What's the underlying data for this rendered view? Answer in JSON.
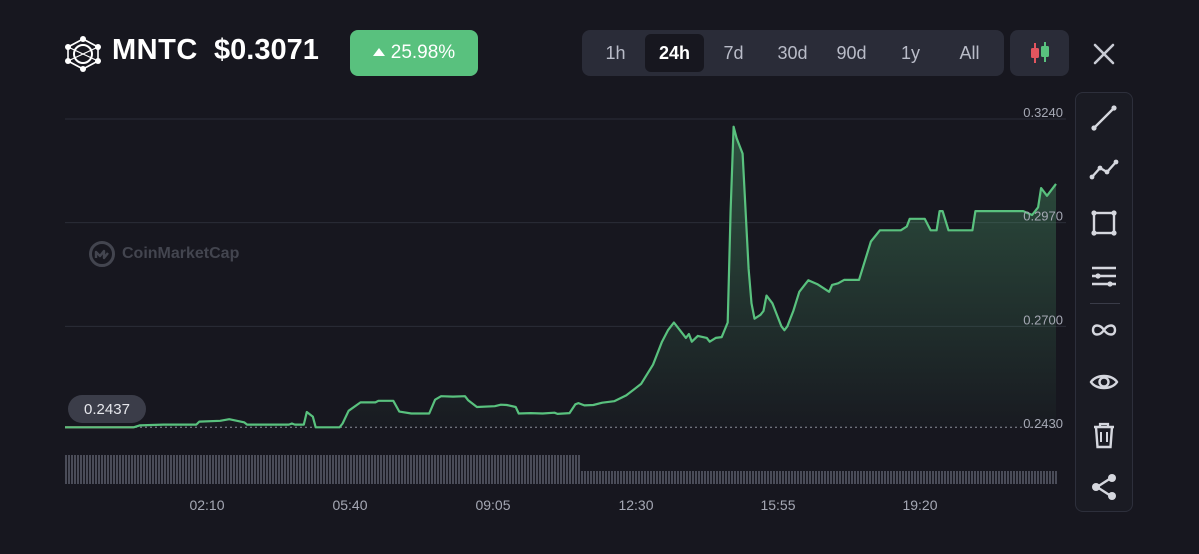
{
  "header": {
    "symbol": "MNTC",
    "price": "$0.3071",
    "change": "25.98%",
    "logo_icon": "network-globe-icon"
  },
  "range_tabs": [
    {
      "label": "1h",
      "active": false
    },
    {
      "label": "24h",
      "active": true
    },
    {
      "label": "7d",
      "active": false
    },
    {
      "label": "30d",
      "active": false
    },
    {
      "label": "90d",
      "active": false
    },
    {
      "label": "1y",
      "active": false
    },
    {
      "label": "All",
      "active": false
    }
  ],
  "toolbar": [
    "trend-line-icon",
    "multi-line-icon",
    "rectangle-icon",
    "horizontal-lines-icon",
    "infinity-icon",
    "eye-icon",
    "trash-icon",
    "share-icon"
  ],
  "watermark": "CoinMarketCap",
  "current_value_label": "0.2437",
  "colors": {
    "up": "#59c17e",
    "down": "#e2555f",
    "background": "#17171f"
  },
  "chart_data": {
    "type": "area",
    "ylim": [
      0.243,
      0.324
    ],
    "yticks": [
      "0.3240",
      "0.2970",
      "0.2700",
      "0.2430"
    ],
    "reference_value": 0.2437,
    "x_range": [
      "00:00",
      "23:45"
    ],
    "xticks": [
      "02:10",
      "05:40",
      "09:05",
      "12:30",
      "15:55",
      "19:20"
    ],
    "grid": true,
    "points": [
      [
        "00:00",
        0.2437
      ],
      [
        "01:55",
        0.2437
      ],
      [
        "02:05",
        0.2442
      ],
      [
        "02:45",
        0.2444
      ],
      [
        "03:40",
        0.2444
      ],
      [
        "03:45",
        0.2452
      ],
      [
        "04:20",
        0.2454
      ],
      [
        "04:35",
        0.2458
      ],
      [
        "05:00",
        0.245
      ],
      [
        "05:05",
        0.2444
      ],
      [
        "05:10",
        0.2444
      ],
      [
        "06:15",
        0.2444
      ],
      [
        "06:20",
        0.2447
      ],
      [
        "06:25",
        0.2444
      ],
      [
        "06:40",
        0.2444
      ],
      [
        "06:45",
        0.2477
      ],
      [
        "06:55",
        0.2465
      ],
      [
        "07:00",
        0.2437
      ],
      [
        "07:20",
        0.2437
      ],
      [
        "07:40",
        0.2437
      ],
      [
        "07:45",
        0.2447
      ],
      [
        "07:55",
        0.248
      ],
      [
        "08:15",
        0.2502
      ],
      [
        "08:30",
        0.2502
      ],
      [
        "08:40",
        0.2502
      ],
      [
        "08:45",
        0.2506
      ],
      [
        "09:00",
        0.2506
      ],
      [
        "09:10",
        0.2506
      ],
      [
        "09:20",
        0.2478
      ],
      [
        "09:40",
        0.2473
      ],
      [
        "10:10",
        0.2473
      ],
      [
        "10:20",
        0.2509
      ],
      [
        "10:30",
        0.2518
      ],
      [
        "10:50",
        0.2517
      ],
      [
        "11:10",
        0.2518
      ],
      [
        "11:15",
        0.2508
      ],
      [
        "11:30",
        0.249
      ],
      [
        "12:00",
        0.2492
      ],
      [
        "12:10",
        0.2496
      ],
      [
        "12:20",
        0.2495
      ],
      [
        "12:35",
        0.249
      ],
      [
        "12:40",
        0.2473
      ],
      [
        "13:00",
        0.2474
      ],
      [
        "13:20",
        0.2473
      ],
      [
        "13:40",
        0.2475
      ],
      [
        "13:45",
        0.2472
      ],
      [
        "14:05",
        0.2474
      ],
      [
        "14:15",
        0.2497
      ],
      [
        "14:20",
        0.25
      ],
      [
        "14:30",
        0.2494
      ],
      [
        "14:45",
        0.2495
      ],
      [
        "15:00",
        0.2501
      ],
      [
        "15:20",
        0.2505
      ],
      [
        "15:40",
        0.252
      ],
      [
        "16:05",
        0.255
      ],
      [
        "16:25",
        0.26
      ],
      [
        "16:40",
        0.266
      ],
      [
        "16:50",
        0.269
      ],
      [
        "17:00",
        0.271
      ],
      [
        "17:10",
        0.269
      ],
      [
        "17:20",
        0.267
      ],
      [
        "17:25",
        0.268
      ],
      [
        "17:30",
        0.266
      ],
      [
        "17:40",
        0.2675
      ],
      [
        "17:55",
        0.267
      ],
      [
        "18:00",
        0.266
      ],
      [
        "18:10",
        0.267
      ],
      [
        "18:20",
        0.2672
      ],
      [
        "18:30",
        0.271
      ],
      [
        "18:35",
        0.3
      ],
      [
        "18:40",
        0.322
      ],
      [
        "18:45",
        0.319
      ],
      [
        "18:50",
        0.317
      ],
      [
        "18:55",
        0.315
      ],
      [
        "19:00",
        0.3
      ],
      [
        "19:05",
        0.285
      ],
      [
        "19:10",
        0.276
      ],
      [
        "19:15",
        0.272
      ],
      [
        "19:25",
        0.273
      ],
      [
        "19:30",
        0.274
      ],
      [
        "19:35",
        0.278
      ],
      [
        "19:45",
        0.276
      ],
      [
        "19:50",
        0.274
      ],
      [
        "20:00",
        0.27
      ],
      [
        "20:05",
        0.269
      ],
      [
        "20:10",
        0.27
      ],
      [
        "20:15",
        0.272
      ],
      [
        "20:20",
        0.274
      ],
      [
        "20:30",
        0.279
      ],
      [
        "20:40",
        0.281
      ],
      [
        "20:45",
        0.282
      ],
      [
        "21:00",
        0.281
      ],
      [
        "21:10",
        0.28
      ],
      [
        "21:20",
        0.279
      ],
      [
        "21:25",
        0.2808
      ],
      [
        "21:35",
        0.2812
      ],
      [
        "21:45",
        0.2821
      ],
      [
        "22:10",
        0.2821
      ],
      [
        "22:30",
        0.2921
      ],
      [
        "22:45",
        0.295
      ],
      [
        "23:00",
        0.295
      ],
      [
        "23:20",
        0.295
      ],
      [
        "23:30",
        0.296
      ],
      [
        "23:35",
        0.298
      ],
      [
        "23:45",
        0.298
      ],
      [
        "00:00",
        0.298
      ],
      [
        "00:10",
        0.295
      ],
      [
        "00:20",
        0.295
      ],
      [
        "00:25",
        0.3
      ],
      [
        "00:30",
        0.3
      ],
      [
        "00:40",
        0.295
      ],
      [
        "01:20",
        0.295
      ],
      [
        "01:25",
        0.3
      ],
      [
        "02:00",
        0.3
      ],
      [
        "02:30",
        0.3
      ],
      [
        "02:45",
        0.3
      ],
      [
        "03:00",
        0.299
      ],
      [
        "03:10",
        0.301
      ],
      [
        "03:15",
        0.306
      ],
      [
        "03:25",
        0.304
      ],
      [
        "03:40",
        0.3071
      ]
    ]
  }
}
